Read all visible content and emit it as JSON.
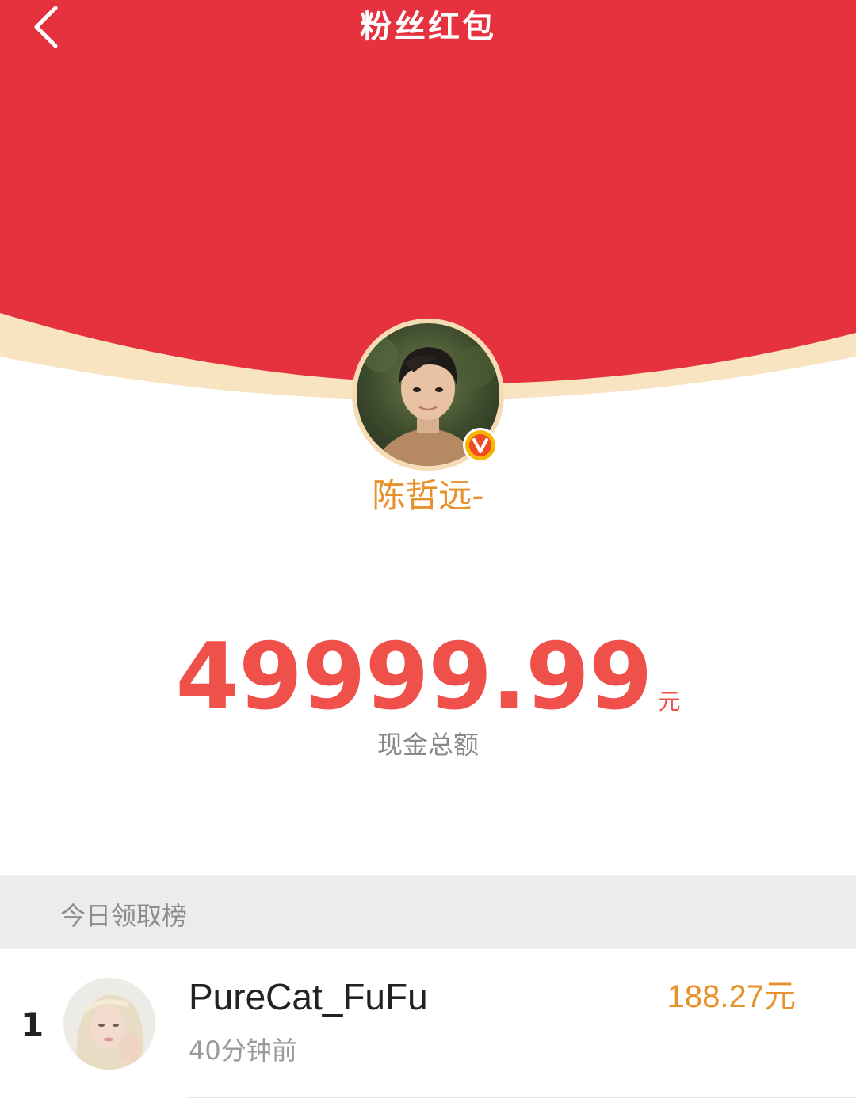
{
  "header": {
    "title": "粉丝红包",
    "back_icon": "chevron-left-icon",
    "colors": {
      "red": "#e5323e",
      "cream": "#f9e4c2"
    }
  },
  "profile": {
    "name": "陈哲远-",
    "verified_icon": "verified-v-icon",
    "name_color": "#e8912a"
  },
  "amount": {
    "value": "49999.99",
    "unit": "元",
    "label": "现金总额",
    "color": "#f0504a"
  },
  "leaderboard": {
    "title": "今日领取榜",
    "items": [
      {
        "rank": "1",
        "name": "PureCat_FuFu",
        "time": "40分钟前",
        "amount": "188.27元"
      }
    ]
  }
}
